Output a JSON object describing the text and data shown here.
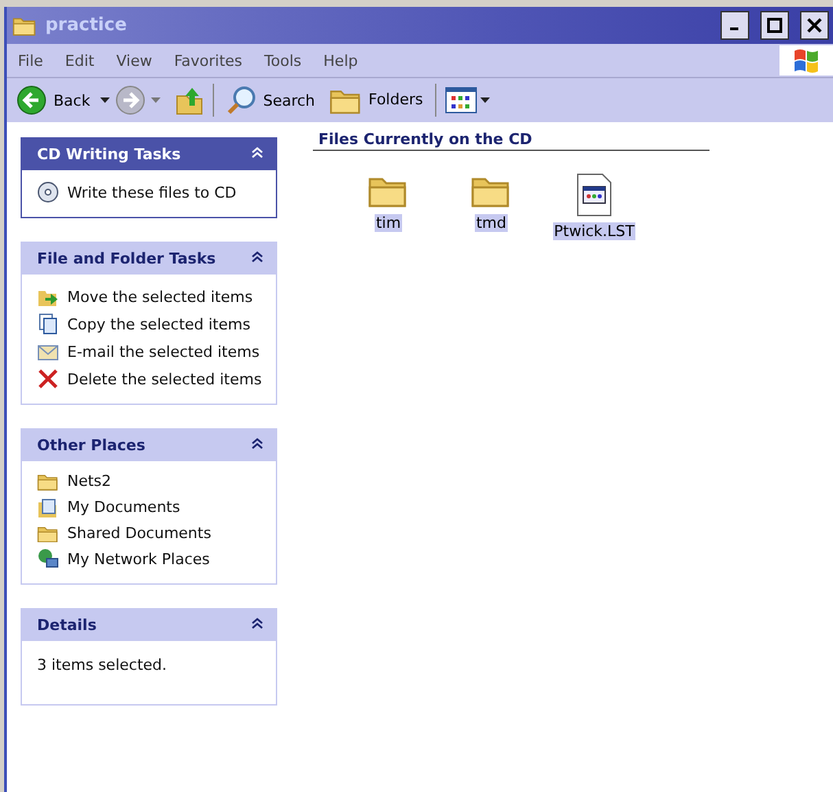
{
  "window": {
    "title": "practice"
  },
  "menu": [
    "File",
    "Edit",
    "View",
    "Favorites",
    "Tools",
    "Help"
  ],
  "toolbar": {
    "back": "Back",
    "search": "Search",
    "folders": "Folders"
  },
  "panels": [
    {
      "title": "CD Writing Tasks",
      "special": true,
      "items": [
        "Write these files to CD"
      ]
    },
    {
      "title": "File and Folder Tasks",
      "special": false,
      "items": [
        "Move the selected items",
        "Copy the selected items",
        "E-mail the selected items",
        "Delete the selected items"
      ]
    },
    {
      "title": "Other Places",
      "special": false,
      "items": [
        "Nets2",
        "My Documents",
        "Shared Documents",
        "My Network Places"
      ]
    },
    {
      "title": "Details",
      "special": false,
      "text": "3 items selected."
    }
  ],
  "group": {
    "title": "Files Currently on the CD"
  },
  "files": [
    {
      "name": "tim",
      "kind": "folder",
      "selected": true
    },
    {
      "name": "tmd",
      "kind": "folder",
      "selected": true
    },
    {
      "name": "Ptwick.LST",
      "kind": "file",
      "selected": true
    }
  ]
}
